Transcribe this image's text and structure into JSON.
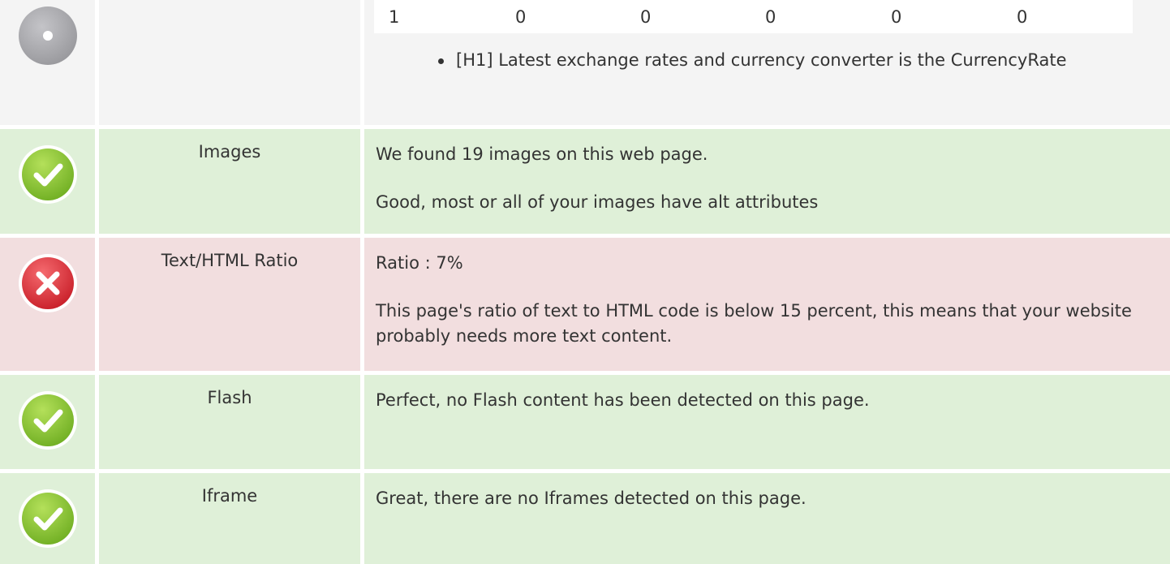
{
  "headings_row": {
    "counts": [
      "1",
      "0",
      "0",
      "0",
      "0",
      "0"
    ],
    "headings_list": [
      "[H1] Latest exchange rates and currency converter is the CurrencyRate"
    ]
  },
  "rows": [
    {
      "status": "pass",
      "name": "Images",
      "lines": [
        "We found 19 images on this web page.",
        "Good, most or all of your images have alt attributes"
      ]
    },
    {
      "status": "fail",
      "name": "Text/HTML Ratio",
      "lines": [
        "Ratio : 7%",
        "This page's ratio of text to HTML code is below 15 percent, this means that your website probably needs more text content."
      ]
    },
    {
      "status": "pass",
      "name": "Flash",
      "lines": [
        "Perfect, no Flash content has been detected on this page."
      ]
    },
    {
      "status": "pass",
      "name": "Iframe",
      "lines": [
        "Great, there are no Iframes detected on this page."
      ]
    }
  ],
  "colors": {
    "pass_background": "#dff0d8",
    "fail_background": "#f2dedf",
    "neutral_background": "#f4f4f4",
    "pass_icon": "#8cc63f",
    "fail_icon": "#e0303a",
    "neutral_icon": "#a8a8ac"
  },
  "icons": {
    "neutral": "neutral-dot-icon",
    "pass": "check-circle-icon",
    "fail": "x-circle-icon"
  }
}
